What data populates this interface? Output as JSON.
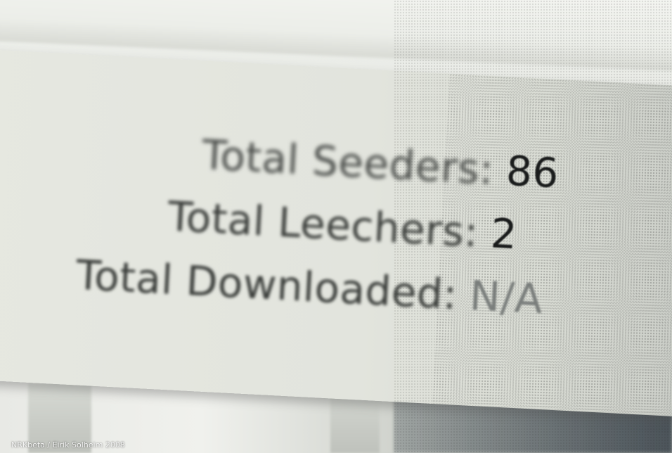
{
  "stats": {
    "seeders": {
      "label": "Total Seeders:",
      "value": "86"
    },
    "leechers": {
      "label": "Total Leechers:",
      "value": "2"
    },
    "downloaded": {
      "label": "Total Downloaded:",
      "value": "N/A"
    }
  },
  "credit": "NRKbeta / Eirik Solheim 2008"
}
